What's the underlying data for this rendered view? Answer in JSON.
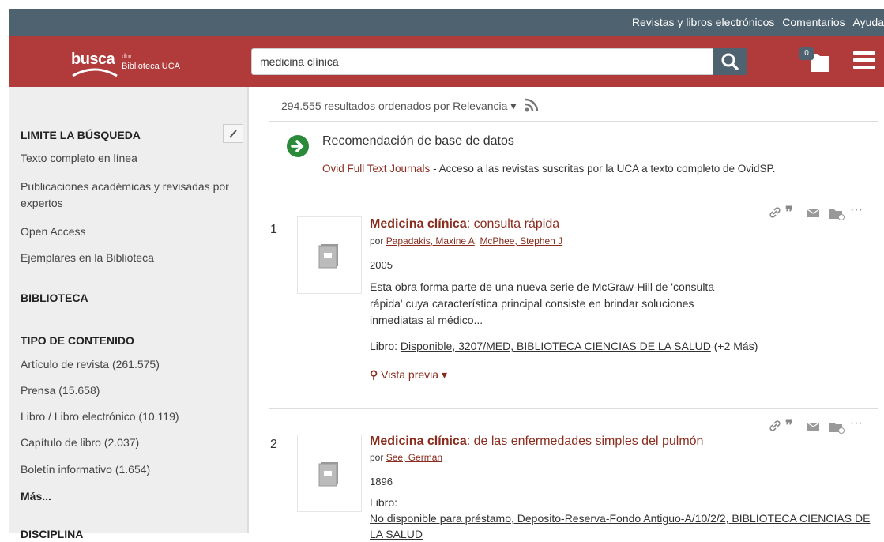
{
  "topbar": {
    "links": [
      "Revistas y libros electrónicos",
      "Comentarios",
      "Ayuda"
    ]
  },
  "logo": {
    "main": "busca",
    "suffix": "dor",
    "sub": "Biblioteca UCA"
  },
  "search": {
    "value": "medicina clínica"
  },
  "folder": {
    "count": "0"
  },
  "sidebar": {
    "limit_title": "LIMITE LA BÚSQUEDA",
    "limits": [
      "Texto completo en línea",
      "Publicaciones académicas y revisadas por expertos",
      "Open Access",
      "Ejemplares en la Biblioteca"
    ],
    "library_title": "BIBLIOTECA",
    "type_title": "TIPO DE CONTENIDO",
    "types": [
      "Artículo de revista (261.575)",
      "Prensa (15.658)",
      "Libro / Libro electrónico (10.119)",
      "Capítulo de libro (2.037)",
      "Boletín informativo (1.654)"
    ],
    "more": "Más...",
    "discipline_title": "DISCIPLINA"
  },
  "results": {
    "count_text": "294.555 resultados ordenados por",
    "sort": "Relevancia",
    "recommendation": {
      "title": "Recomendación de base de datos",
      "db_link": "Ovid Full Text Journals",
      "desc": " - Acceso a las revistas suscritas por la UCA a texto completo de OvidSP."
    },
    "items": [
      {
        "number": "1",
        "title_bold": "Medicina clínica",
        "title_rest": ": consulta rápida",
        "by": "por",
        "authors": [
          "Papadakis, Maxine A",
          "McPhee, Stephen J"
        ],
        "year": "2005",
        "description": "Esta obra forma parte de una nueva serie de McGraw-Hill de 'consulta rápida' cuya característica principal consiste en brindar soluciones inmediatas al médico...",
        "avail_label": "Libro:",
        "avail_link": "Disponible, 3207/MED, BIBLIOTECA CIENCIAS DE LA SALUD",
        "avail_more": "(+2 Más)",
        "preview": "Vista previa"
      },
      {
        "number": "2",
        "title_bold": "Medicina clínica",
        "title_rest": ": de las enfermedades simples del pulmón",
        "by": "por",
        "authors": [
          "See, German"
        ],
        "year": "1896",
        "avail_label": "Libro:",
        "avail_link": "No disponible para préstamo, Deposito-Reserva-Fondo Antiguo-A/10/2/2, BIBLIOTECA CIENCIAS DE LA SALUD"
      }
    ]
  },
  "colors": {
    "header": "#b13a3a",
    "topbar": "#4e6270",
    "link": "#8a2d1f",
    "recommend": "#2a8a3a"
  }
}
